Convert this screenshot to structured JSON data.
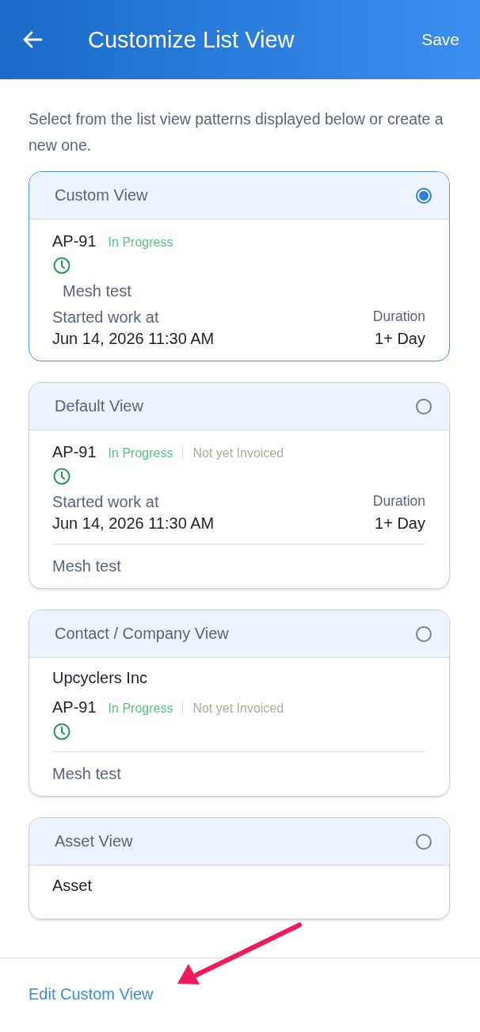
{
  "app_bar": {
    "title": "Customize List View",
    "action": "Save"
  },
  "intro": "Select from the list view patterns displayed below or create a new one.",
  "views": [
    {
      "title": "Custom View",
      "selected": true,
      "rows": [
        {
          "kind": "status",
          "id": "AP-91",
          "status": "In Progress"
        },
        {
          "kind": "clock"
        },
        {
          "kind": "note",
          "text": "Mesh test"
        },
        {
          "kind": "started",
          "label": "Started work at",
          "value": "Jun 14, 2026 11:30 AM",
          "duration_label": "Duration",
          "duration": "1+ Day"
        }
      ]
    },
    {
      "title": "Default View",
      "selected": false,
      "rows": [
        {
          "kind": "status",
          "id": "AP-91",
          "status": "In Progress",
          "invoice": "Not yet Invoiced"
        },
        {
          "kind": "clock"
        },
        {
          "kind": "started",
          "label": "Started work at",
          "value": "Jun 14, 2026 11:30 AM",
          "duration_label": "Duration",
          "duration": "1+ Day"
        },
        {
          "kind": "footnote",
          "text": "Mesh test"
        }
      ]
    },
    {
      "title": "Contact / Company View",
      "selected": false,
      "rows": [
        {
          "kind": "company",
          "text": "Upcyclers Inc"
        },
        {
          "kind": "status",
          "id": "AP-91",
          "status": "In Progress",
          "invoice": "Not yet Invoiced"
        },
        {
          "kind": "clock"
        },
        {
          "kind": "footnote",
          "text": "Mesh test"
        }
      ]
    },
    {
      "title": "Asset View",
      "selected": false,
      "rows": [
        {
          "kind": "company",
          "text": "Asset"
        }
      ]
    }
  ],
  "footer": {
    "link": "Edit Custom View"
  }
}
